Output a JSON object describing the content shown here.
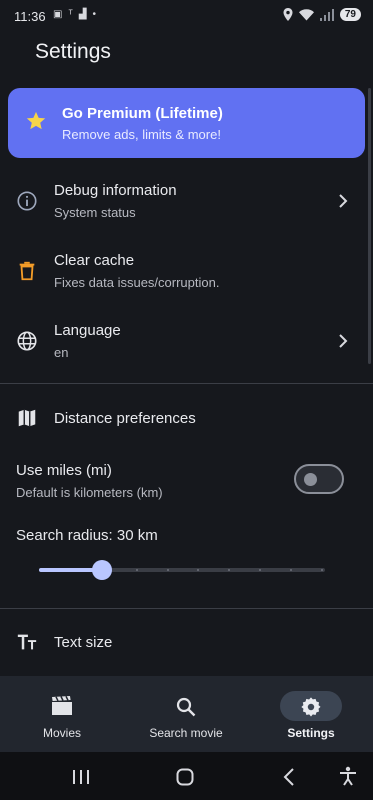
{
  "status_bar": {
    "time": "11:36",
    "left_icons": [
      "screenshot-icon",
      "notification-icon",
      "shop-icon",
      "dot-icon"
    ],
    "right_icons": [
      "location-icon",
      "wifi-icon",
      "signal-icon"
    ],
    "battery": "79"
  },
  "page": {
    "title": "Settings"
  },
  "premium": {
    "title": "Go Premium (Lifetime)",
    "subtitle": "Remove ads, limits & more!",
    "color": "#6171f2"
  },
  "settings": [
    {
      "title": "Debug information",
      "subtitle": "System status",
      "icon": "info-icon",
      "chevron": true
    },
    {
      "title": "Clear cache",
      "subtitle": "Fixes data issues/corruption.",
      "icon": "trash-icon",
      "chevron": false
    },
    {
      "title": "Language",
      "subtitle": "en",
      "icon": "globe-icon",
      "chevron": true
    }
  ],
  "distance": {
    "section_title": "Distance preferences",
    "icon": "map-icon",
    "use_miles": {
      "title": "Use miles (mi)",
      "subtitle": "Default is kilometers (km)",
      "enabled": false
    },
    "radius": {
      "label": "Search radius: 30 km",
      "value_fraction": 0.22
    }
  },
  "text_size": {
    "title": "Text size",
    "icon": "text-size-icon"
  },
  "bottom_nav": [
    {
      "label": "Movies",
      "icon": "clapperboard-icon",
      "active": false
    },
    {
      "label": "Search movie",
      "icon": "search-icon",
      "active": false
    },
    {
      "label": "Settings",
      "icon": "gear-icon",
      "active": true
    }
  ],
  "system_nav": [
    "recents-icon",
    "home-icon",
    "back-icon",
    "accessibility-icon"
  ],
  "colors": {
    "background": "#16181d",
    "accent": "#b9c6ff",
    "premium": "#6171f2",
    "warning": "#f39c28"
  }
}
